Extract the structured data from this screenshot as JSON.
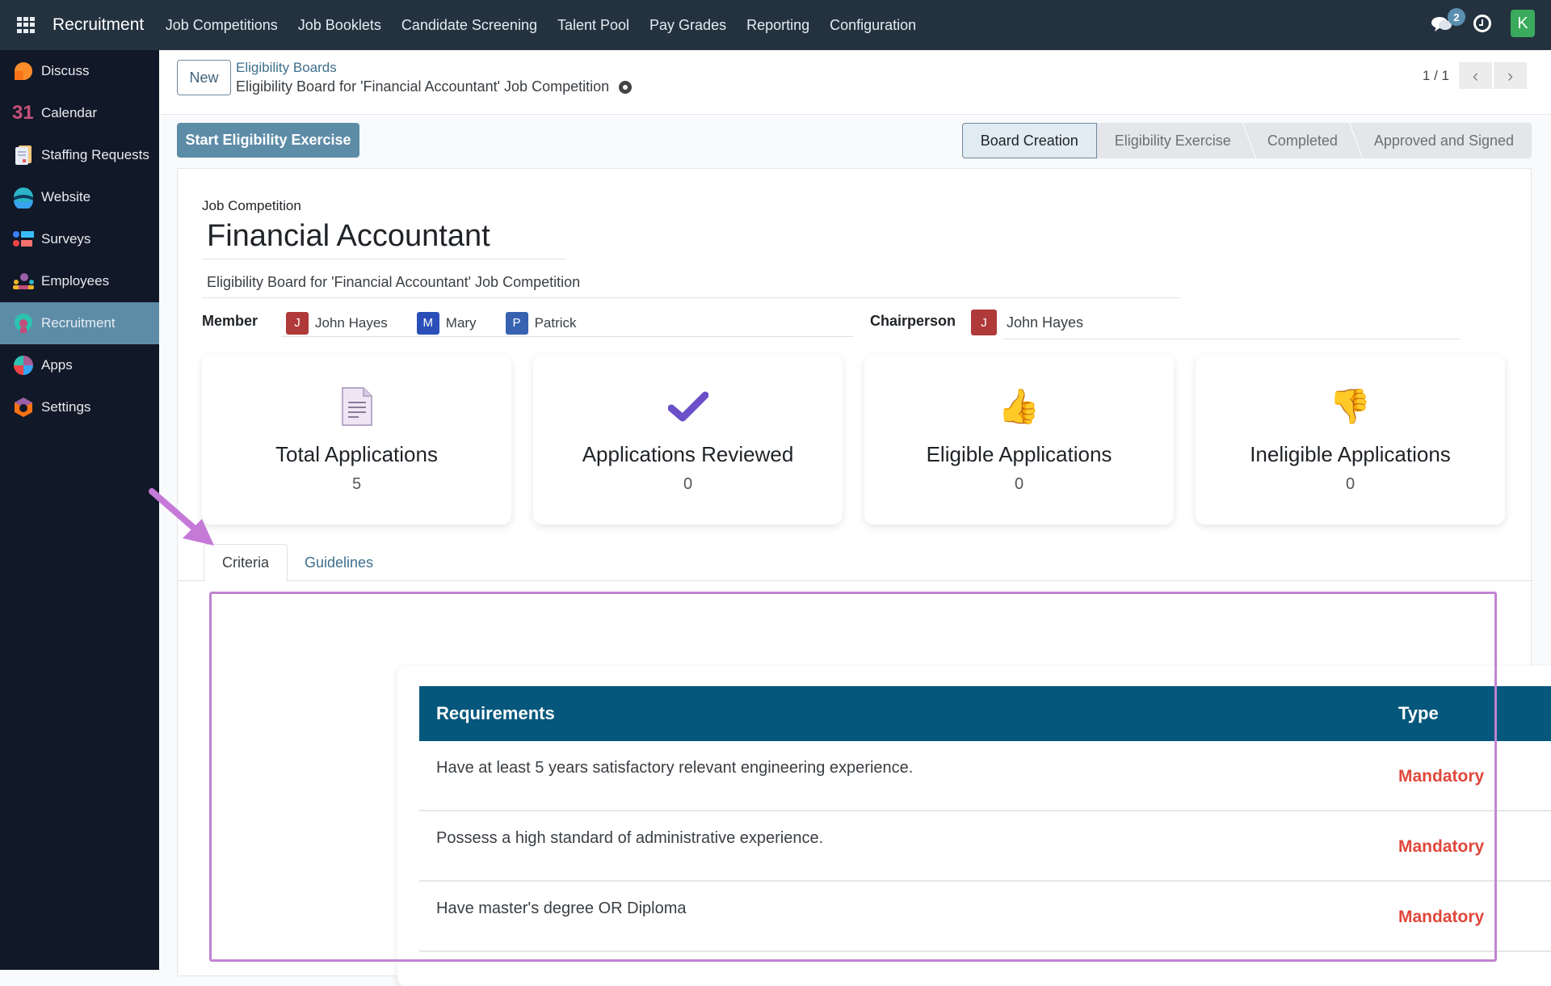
{
  "topbar": {
    "brand": "Recruitment",
    "nav": [
      "Job Competitions",
      "Job Booklets",
      "Candidate Screening",
      "Talent Pool",
      "Pay Grades",
      "Reporting",
      "Configuration"
    ],
    "chat_count": "2",
    "user_initial": "K",
    "colors": {
      "bg": "#243240",
      "avatar": "#3aaa5c"
    }
  },
  "sidebar": {
    "items": [
      {
        "label": "Discuss",
        "icon": "discuss-icon"
      },
      {
        "label": "Calendar",
        "icon": "calendar-icon",
        "glyph": "31"
      },
      {
        "label": "Staffing Requests",
        "icon": "staffing-requests-icon"
      },
      {
        "label": "Website",
        "icon": "website-icon"
      },
      {
        "label": "Surveys",
        "icon": "surveys-icon"
      },
      {
        "label": "Employees",
        "icon": "employees-icon"
      },
      {
        "label": "Recruitment",
        "icon": "recruitment-icon",
        "active": true
      },
      {
        "label": "Apps",
        "icon": "apps-icon"
      },
      {
        "label": "Settings",
        "icon": "settings-icon"
      }
    ]
  },
  "control_panel": {
    "new_label": "New",
    "breadcrumb_parent": "Eligibility Boards",
    "breadcrumb_current": "Eligibility Board for 'Financial Accountant' Job Competition",
    "pager": "1 / 1",
    "prev": "‹",
    "next": "›"
  },
  "actions": {
    "start_label": "Start Eligibility Exercise"
  },
  "statusbar": {
    "stages": [
      "Board Creation",
      "Eligibility Exercise",
      "Completed",
      "Approved and Signed"
    ],
    "active": "Board Creation"
  },
  "form": {
    "job_competition_label": "Job Competition",
    "job_competition": "Financial Accountant",
    "description": "Eligibility Board for 'Financial Accountant' Job Competition",
    "member_label": "Member",
    "members": [
      {
        "initial": "J",
        "name": "John Hayes",
        "color": "#b03a3a"
      },
      {
        "initial": "M",
        "name": "Mary",
        "color": "#2a4fb8"
      },
      {
        "initial": "P",
        "name": "Patrick",
        "color": "#3662b0"
      }
    ],
    "chairperson_label": "Chairperson",
    "chairperson": {
      "initial": "J",
      "name": "John Hayes",
      "color": "#b03a3a"
    }
  },
  "stats": [
    {
      "label": "Total Applications",
      "value": "5",
      "icon": "document-icon"
    },
    {
      "label": "Applications Reviewed",
      "value": "0",
      "icon": "checkmark-icon"
    },
    {
      "label": "Eligible Applications",
      "value": "0",
      "icon": "thumbs-up-icon",
      "glyph": "👍"
    },
    {
      "label": "Ineligible Applications",
      "value": "0",
      "icon": "thumbs-down-icon",
      "glyph": "👎"
    }
  ],
  "tabs": {
    "criteria": "Criteria",
    "guidelines": "Guidelines",
    "active": "Criteria"
  },
  "criteria": {
    "headers": {
      "requirements": "Requirements",
      "type": "Type"
    },
    "rows": [
      {
        "requirement": "Have at least 5 years satisfactory relevant engineering experience.",
        "type": "Mandatory"
      },
      {
        "requirement": "Possess a high standard of administrative experience.",
        "type": "Mandatory"
      },
      {
        "requirement": "Have master's degree OR Diploma",
        "type": "Mandatory"
      }
    ],
    "colors": {
      "header": "#06577c",
      "mandatory": "#e0473b",
      "highlight": "#c084d0"
    }
  }
}
